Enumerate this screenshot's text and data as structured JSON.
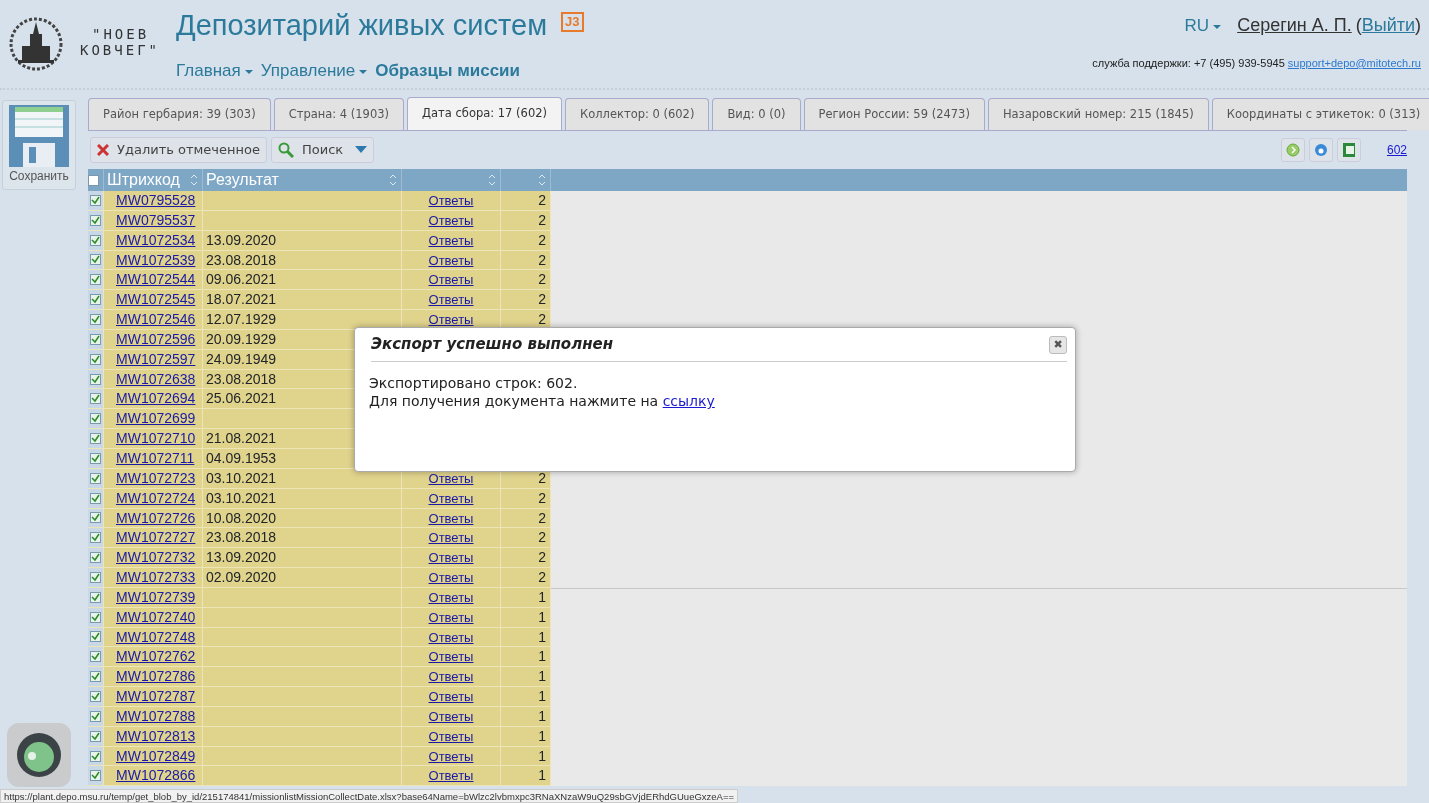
{
  "logo": {
    "line1": "\"НОЕВ",
    "line2": "КОВЧЕГ\""
  },
  "site_title": "Депозитарий живых систем",
  "title_badge": "J3",
  "nav": [
    {
      "label": "Главная",
      "dropdown": true,
      "selected": false
    },
    {
      "label": "Управление",
      "dropdown": true,
      "selected": false
    },
    {
      "label": "Образцы миссии",
      "dropdown": false,
      "selected": true
    }
  ],
  "language": "RU",
  "user": "Серегин А. П.",
  "logout_open": "(",
  "logout": "Выйти",
  "logout_close": ")",
  "support": {
    "text": "служба поддержки: +7 (495) 939-5945",
    "email": "support+depo@mitotech.ru"
  },
  "save_button": "Сохранить",
  "tabs": [
    {
      "label": "Район гербария: 39 (303)",
      "selected": false
    },
    {
      "label": "Страна: 4 (1903)",
      "selected": false
    },
    {
      "label": "Дата сбора: 17 (602)",
      "selected": true
    },
    {
      "label": "Коллектор: 0 (602)",
      "selected": false
    },
    {
      "label": "Вид: 0 (0)",
      "selected": false
    },
    {
      "label": "Регион России: 59 (2473)",
      "selected": false
    },
    {
      "label": "Назаровский номер: 215 (1845)",
      "selected": false
    },
    {
      "label": "Координаты с этикеток: 0 (313)",
      "selected": false
    }
  ],
  "toolbar": {
    "delete": "Удалить отмеченное",
    "search": "Поиск",
    "total": "602"
  },
  "table": {
    "select_all": false,
    "columns": [
      "Штрихкод",
      "Результат"
    ],
    "rows": [
      {
        "barcode": "MW0795528",
        "result": "",
        "answers": "Ответы",
        "count": "2",
        "checked": true
      },
      {
        "barcode": "MW0795537",
        "result": "",
        "answers": "Ответы",
        "count": "2",
        "checked": true
      },
      {
        "barcode": "MW1072534",
        "result": "13.09.2020",
        "answers": "Ответы",
        "count": "2",
        "checked": true
      },
      {
        "barcode": "MW1072539",
        "result": "23.08.2018",
        "answers": "Ответы",
        "count": "2",
        "checked": true
      },
      {
        "barcode": "MW1072544",
        "result": "09.06.2021",
        "answers": "Ответы",
        "count": "2",
        "checked": true
      },
      {
        "barcode": "MW1072545",
        "result": "18.07.2021",
        "answers": "Ответы",
        "count": "2",
        "checked": true
      },
      {
        "barcode": "MW1072546",
        "result": "12.07.1929",
        "answers": "Ответы",
        "count": "2",
        "checked": true
      },
      {
        "barcode": "MW1072596",
        "result": "20.09.1929",
        "checked": true
      },
      {
        "barcode": "MW1072597",
        "result": "24.09.1949",
        "checked": true
      },
      {
        "barcode": "MW1072638",
        "result": "23.08.2018",
        "checked": true
      },
      {
        "barcode": "MW1072694",
        "result": "25.06.2021",
        "checked": true
      },
      {
        "barcode": "MW1072699",
        "result": "",
        "checked": true
      },
      {
        "barcode": "MW1072710",
        "result": "21.08.2021",
        "checked": true
      },
      {
        "barcode": "MW1072711",
        "result": "04.09.1953",
        "checked": true
      },
      {
        "barcode": "MW1072723",
        "result": "03.10.2021",
        "answers": "Ответы",
        "count": "2",
        "checked": true
      },
      {
        "barcode": "MW1072724",
        "result": "03.10.2021",
        "answers": "Ответы",
        "count": "2",
        "checked": true
      },
      {
        "barcode": "MW1072726",
        "result": "10.08.2020",
        "answers": "Ответы",
        "count": "2",
        "checked": true
      },
      {
        "barcode": "MW1072727",
        "result": "23.08.2018",
        "answers": "Ответы",
        "count": "2",
        "checked": true
      },
      {
        "barcode": "MW1072732",
        "result": "13.09.2020",
        "answers": "Ответы",
        "count": "2",
        "checked": true
      },
      {
        "barcode": "MW1072733",
        "result": "02.09.2020",
        "answers": "Ответы",
        "count": "2",
        "checked": true
      },
      {
        "barcode": "MW1072739",
        "result": "",
        "answers": "Ответы",
        "count": "1",
        "checked": true
      },
      {
        "barcode": "MW1072740",
        "result": "",
        "answers": "Ответы",
        "count": "1",
        "checked": true
      },
      {
        "barcode": "MW1072748",
        "result": "",
        "answers": "Ответы",
        "count": "1",
        "checked": true
      },
      {
        "barcode": "MW1072762",
        "result": "",
        "answers": "Ответы",
        "count": "1",
        "checked": true
      },
      {
        "barcode": "MW1072786",
        "result": "",
        "answers": "Ответы",
        "count": "1",
        "checked": true
      },
      {
        "barcode": "MW1072787",
        "result": "",
        "answers": "Ответы",
        "count": "1",
        "checked": true
      },
      {
        "barcode": "MW1072788",
        "result": "",
        "answers": "Ответы",
        "count": "1",
        "checked": true
      },
      {
        "barcode": "MW1072813",
        "result": "",
        "answers": "Ответы",
        "count": "1",
        "checked": true
      },
      {
        "barcode": "MW1072849",
        "result": "",
        "answers": "Ответы",
        "count": "1",
        "checked": true
      },
      {
        "barcode": "MW1072866",
        "result": "",
        "answers": "Ответы",
        "count": "1",
        "checked": true
      }
    ]
  },
  "dialog": {
    "title": "Экспорт успешно выполнен",
    "line1": "Экспортировано строк: 602.",
    "line2": "Для получения документа нажмите на",
    "link": "ссылку",
    "close": "✖"
  },
  "status_bar": "https://plant.depo.msu.ru/temp/get_blob_by_id/215174841/missionlistMissionCollectDate.xlsx?base64Name=bWlzc2lvbmxpc3RNaXNzaW9uQ29sbGVjdERhdGUueGxzeA=="
}
